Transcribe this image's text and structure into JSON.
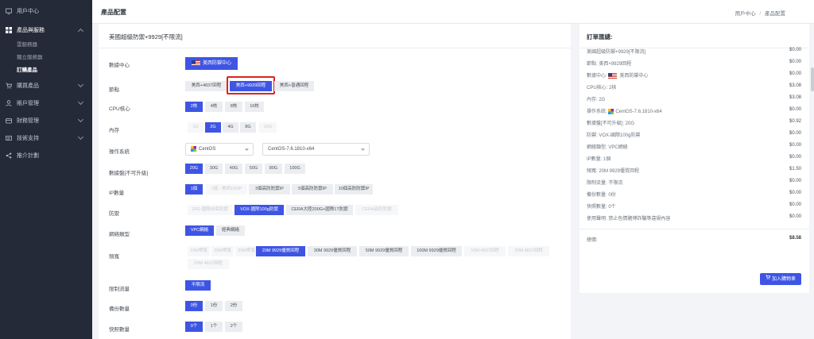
{
  "sidebar": {
    "items": [
      {
        "label": "用戶中心"
      },
      {
        "label": "產品與服務"
      },
      {
        "label": "購買產品"
      },
      {
        "label": "賬戶管理"
      },
      {
        "label": "財務管理"
      },
      {
        "label": "技術支持"
      },
      {
        "label": "推介計劃"
      }
    ],
    "sub_items": [
      {
        "label": "雲服務器"
      },
      {
        "label": "獨立服務器"
      },
      {
        "label": "訂購產品"
      }
    ]
  },
  "header": {
    "title": "產品配置",
    "breadcrumb_home": "用戶中心",
    "breadcrumb_sep": "/",
    "breadcrumb_current": "產品配置"
  },
  "config": {
    "product_title": "美國超級防禦+9929[不限流]",
    "rows": {
      "datacenter": {
        "label": "數據中心",
        "value": "美西防禦中心"
      },
      "node": {
        "label": "節點",
        "options": [
          "美西+4837回程",
          "美西+9929回程",
          "美西+普通回程"
        ]
      },
      "cpu": {
        "label": "CPU核心",
        "options": [
          "2核",
          "4核",
          "8核",
          "16核"
        ]
      },
      "memory": {
        "label": "內存",
        "options": [
          "1G",
          "2G",
          "4G",
          "8G",
          "16G"
        ]
      },
      "os": {
        "label": "操作系統",
        "family": "CentOS",
        "version": "CentOS-7.6.1810-x64"
      },
      "disk": {
        "label": "數據盤[不可升級]",
        "options": [
          "20G",
          "30G",
          "40G",
          "50G",
          "80G",
          "100G"
        ]
      },
      "ip": {
        "label": "IP數量",
        "options": [
          "1個",
          "1個 - 美西100IP",
          "3個高防防禦IP",
          "5個高防防禦IP",
          "10個高防防禦IP"
        ]
      },
      "defense": {
        "label": "防禦",
        "options": [
          "20G-國際自保防禦",
          "VOX-國際100g防禦",
          "CERA大陸200G+國際1T防禦",
          "CERA高防防禦"
        ]
      },
      "network": {
        "label": "網絡類型",
        "options": [
          "VPC網絡",
          "經典網絡"
        ]
      },
      "bandwidth": {
        "label": "頻寬",
        "options": [
          "10M帶寬",
          "20M帶寬",
          "30M帶寬",
          "20M 9929優質回程",
          "30M 9929優質回程",
          "50M 9929優質回程",
          "100M 9929優質回程",
          "10M 4837回程",
          "20M 4837回程",
          "20M 4837回程"
        ]
      },
      "traffic": {
        "label": "限制流量",
        "options": [
          "不限流"
        ]
      },
      "backup": {
        "label": "備份數量",
        "options": [
          "0份",
          "1份",
          "2份"
        ]
      },
      "snapshot": {
        "label": "快照數量",
        "options": [
          "0个",
          "1个",
          "2个"
        ]
      }
    }
  },
  "summary": {
    "title": "訂單匯總:",
    "lines": [
      {
        "label": "美國超級防禦+9929[不限流]",
        "value": "$0.00"
      },
      {
        "label": "節點: 美西+9929回程",
        "value": "$0.00"
      },
      {
        "label": "數據中心:",
        "extra": "美西防禦中心",
        "value": "$0.00"
      },
      {
        "label": "CPU核心: 2核",
        "value": "$3.08"
      },
      {
        "label": "內存: 2G",
        "value": "$3.08"
      },
      {
        "label": "操作系統:",
        "extra": "CentOS-7.6.1810-x64",
        "value": "$0.00"
      },
      {
        "label": "數據盤[不可升級]: 20G",
        "value": "$0.92"
      },
      {
        "label": "防禦: VOX-國際100g防禦",
        "value": "$0.00"
      },
      {
        "label": "網絡類型: VPC網絡",
        "value": "$0.00"
      },
      {
        "label": "IP數量: 1個",
        "value": "$0.00"
      },
      {
        "label": "頻寬: 20M 9929優質回程",
        "value": "$1.50"
      },
      {
        "label": "限制流量: 不限流",
        "value": "$0.00"
      },
      {
        "label": "備份數量: 0份",
        "value": "$0.00"
      },
      {
        "label": "快照數量: 0个",
        "value": "$0.00"
      },
      {
        "label": "使用聲明: 禁止色情賭博詐騙等違規內容",
        "value": "$0.00"
      }
    ],
    "total_label": "總價:",
    "total_value": "$8.58",
    "checkout_label": "加入購物車"
  },
  "colors": {
    "accent": "#3e55e4",
    "sidebar_bg": "#252a38",
    "highlight_border": "#e02020"
  }
}
